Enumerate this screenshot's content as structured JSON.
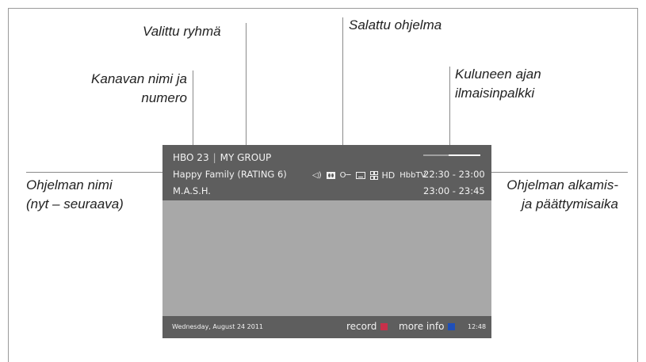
{
  "callouts": {
    "selected_group": "Valittu ryhmä",
    "encrypted_program": "Salattu ohjelma",
    "channel_name_line1": "Kanavan nimi ja",
    "channel_name_line2": "numero",
    "elapsed_line1": "Kuluneen ajan",
    "elapsed_line2": "ilmaisinpalkki",
    "program_name_line1": "Ohjelman nimi",
    "program_name_line2": "(nyt – seuraava)",
    "times_line1": "Ohjelman alkamis-",
    "times_line2": "ja päättymisaika"
  },
  "osd": {
    "channel": "HBO 23",
    "separator": "|",
    "group": "MY GROUP",
    "now_program": "Happy Family (RATING 6)",
    "next_program": "M.A.S.H.",
    "now_time": "22:30 - 23:00",
    "next_time": "23:00 - 23:45",
    "progress_fraction": 0.45,
    "icons": [
      "audio-icon",
      "dolby-icon",
      "key-icon",
      "subtitle-icon",
      "teletext-icon"
    ],
    "key_glyph": "O─",
    "hd_label": "HD",
    "hbbtv_label": "HbbTV"
  },
  "footer": {
    "date": "Wednesday, August 24 2011",
    "record_label": "record",
    "record_color": "#c8304a",
    "more_info_label": "more info",
    "more_info_color": "#1f4fb8",
    "clock": "12:48"
  }
}
